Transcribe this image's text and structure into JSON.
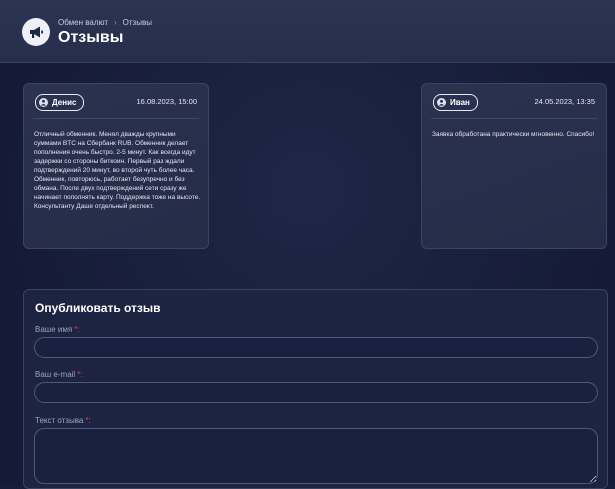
{
  "header": {
    "breadcrumb": [
      "Обмен валют",
      "Отзывы"
    ],
    "breadcrumb_separator": "›",
    "title": "Отзывы",
    "icon": "megaphone-icon"
  },
  "reviews": [
    {
      "author": "Денис",
      "date": "16.08.2023, 15:00",
      "text": "Отличный обменник. Менял дважды крупными суммами BTC на Сбербанк RUB. Обменник делает пополнения очень быстро. 2-5 минут. Как всегда идут задержки со стороны биткоин. Первый раз ждали подтверждений 20 минут, во второй чуть более часа. Обменник, повторюсь, работает безупречно и без обмана. После двух подтверждений сети сразу же начинает пополнять карту. Поддержка тоже на высоте. Консультанту Даше отдельный респект."
    },
    {
      "author": "Иван",
      "date": "24.05.2023, 13:35",
      "text": "Заявка обработана практически мгновенно. Спасибо!"
    }
  ],
  "form": {
    "title": "Опубликовать отзыв",
    "required_mark": "*:",
    "fields": [
      {
        "label": "Ваше имя",
        "value": ""
      },
      {
        "label": "Ваш e-mail",
        "value": ""
      },
      {
        "label": "Текст отзыва",
        "value": ""
      }
    ]
  },
  "colors": {
    "background": "#161d3a",
    "card": "#262e4a",
    "required": "#d8454f"
  }
}
